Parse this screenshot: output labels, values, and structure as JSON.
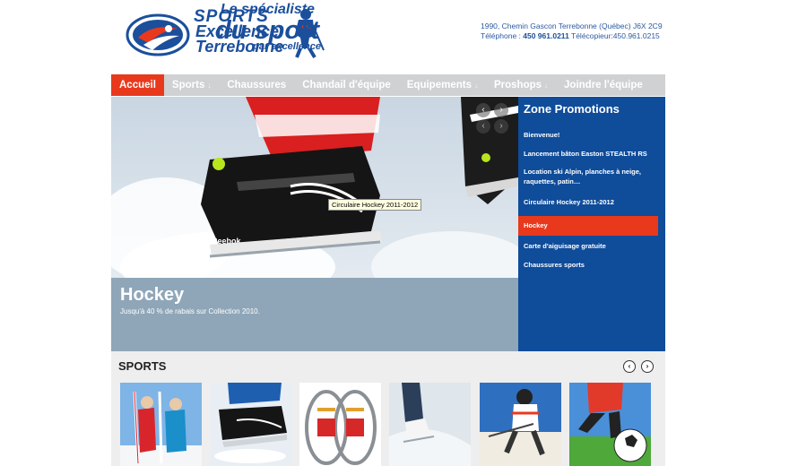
{
  "header": {
    "brand_line1": "SPORTS",
    "brand_line2": "Excellence",
    "brand_line3": "Terrebonne",
    "tagline_top": "Le spécialiste",
    "tagline_main": "du sport",
    "tagline_bottom": "par excellence",
    "address": "1990, Chemin Gascon  Terrebonne (Québec)  J6X 2C9",
    "phone_label": "Téléphone : ",
    "phone": "450 961.0211",
    "fax_label": "  Télécopieur:450.961.0215"
  },
  "nav": {
    "items": [
      {
        "label": "Accueil",
        "arrow": ""
      },
      {
        "label": "Sports",
        "arrow": "↓"
      },
      {
        "label": "Chaussures",
        "arrow": ""
      },
      {
        "label": "Chandail d'équipe",
        "arrow": ""
      },
      {
        "label": "Equipements",
        "arrow": "↓"
      },
      {
        "label": "Proshops",
        "arrow": "↓"
      },
      {
        "label": "Joindre l'équipe",
        "arrow": ""
      }
    ]
  },
  "slider": {
    "title": "Hockey",
    "text": "Jusqu'à 40 % de rabais sur Collection 2010.",
    "tooltip": "Circulaire Hockey 2011-2012",
    "skate_brand": "Reebok"
  },
  "promotions": {
    "title": "Zone Promotions",
    "items": [
      "Bienvenue!",
      "Lancement bâton Easton STEALTH RS",
      "Location ski Alpin, planches à neige,",
      "raquettes, patin…",
      "Circulaire Hockey 2011-2012",
      "Hockey",
      "Carte d'aiguisage gratuite",
      "Chaussures sports"
    ]
  },
  "sports": {
    "title": "SPORTS",
    "prev": "‹",
    "next": "›",
    "thumbs": [
      "ski-thumbnail",
      "skate-thumbnail",
      "snowshoe-thumbnail",
      "figure-skate-thumbnail",
      "roller-hockey-thumbnail",
      "soccer-thumbnail"
    ]
  },
  "colors": {
    "accent_red": "#e8391d",
    "brand_blue": "#0f4c9a",
    "nav_gray": "#cfd1d3"
  }
}
